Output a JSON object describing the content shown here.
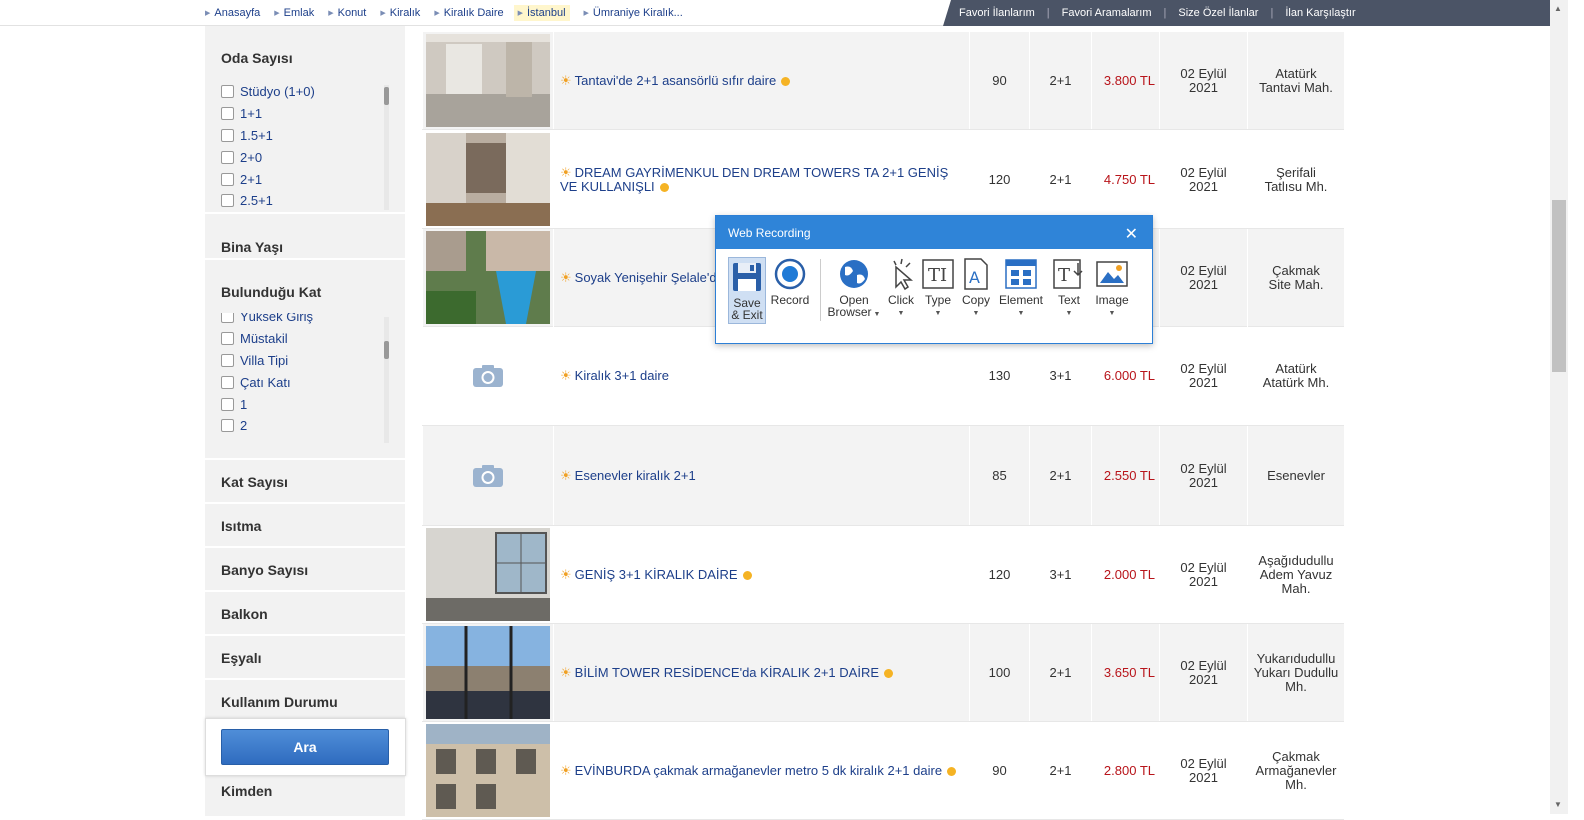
{
  "breadcrumbs": [
    "Anasayfa",
    "Emlak",
    "Konut",
    "Kiralık",
    "Kiralık Daire",
    "İstanbul",
    "Ümraniye Kiralık..."
  ],
  "top_links": [
    "Favori İlanlarım",
    "Favori Aramalarım",
    "Size Özel İlanlar",
    "İlan Karşılaştır"
  ],
  "sidebar": {
    "oda_sayisi": {
      "title": "Oda Sayısı",
      "options": [
        "Stüdyo (1+0)",
        "1+1",
        "1.5+1",
        "2+0",
        "2+1",
        "2.5+1"
      ]
    },
    "bina_yasi": "Bina Yaşı",
    "bulundugu_kat": {
      "title": "Bulunduğu Kat",
      "options": [
        "Yüksek Giriş",
        "Müstakil",
        "Villa Tipi",
        "Çatı Katı",
        "1",
        "2"
      ]
    },
    "kat_sayisi": "Kat Sayısı",
    "isitma": "Isıtma",
    "banyo_sayisi": "Banyo Sayısı",
    "balkon": "Balkon",
    "esyali": "Eşyalı",
    "kullanim_durumu": "Kullanım Durumu",
    "kimden": "Kimden",
    "search_button": "Ara"
  },
  "listings": [
    {
      "title": "Tantavi'de 2+1 asansörlü sıfır daire",
      "m2": "90",
      "rooms": "2+1",
      "price": "3.800 TL",
      "date1": "02 Eylül",
      "date2": "2021",
      "loc1": "Atatürk",
      "loc2": "Tantavi Mah.",
      "loc3": "",
      "photo": "room"
    },
    {
      "title": "DREAM GAYRİMENKUL DEN DREAM TOWERS TA 2+1 GENİŞ VE KULLANIŞLI",
      "m2": "120",
      "rooms": "2+1",
      "price": "4.750 TL",
      "date1": "02 Eylül",
      "date2": "2021",
      "loc1": "Şerifali",
      "loc2": "Tatlısu Mh.",
      "loc3": "",
      "photo": "kitchen"
    },
    {
      "title": "Soyak Yenişehir Şelale'de",
      "m2": "",
      "rooms": "",
      "price": "",
      "date1": "02 Eylül",
      "date2": "2021",
      "loc1": "Çakmak",
      "loc2": "Site Mah.",
      "loc3": "",
      "photo": "pool"
    },
    {
      "title": "Kiralık 3+1 daire",
      "m2": "130",
      "rooms": "3+1",
      "price": "6.000 TL",
      "date1": "02 Eylül",
      "date2": "2021",
      "loc1": "Atatürk",
      "loc2": "Atatürk Mh.",
      "loc3": "",
      "photo": "none"
    },
    {
      "title": "Esenevler kiralık 2+1",
      "m2": "85",
      "rooms": "2+1",
      "price": "2.550 TL",
      "date1": "02 Eylül",
      "date2": "2021",
      "loc1": "Esenevler",
      "loc2": "",
      "loc3": "",
      "photo": "none"
    },
    {
      "title": "GENİŞ 3+1 KİRALIK DAİRE",
      "m2": "120",
      "rooms": "3+1",
      "price": "2.000 TL",
      "date1": "02 Eylül",
      "date2": "2021",
      "loc1": "Aşağıdudullu",
      "loc2": "Adem Yavuz",
      "loc3": "Mah.",
      "photo": "window"
    },
    {
      "title": "BİLİM TOWER RESİDENCE'da KİRALIK 2+1 DAİRE",
      "m2": "100",
      "rooms": "2+1",
      "price": "3.650 TL",
      "date1": "02 Eylül",
      "date2": "2021",
      "loc1": "Yukarıdudullu",
      "loc2": "Yukarı Dudullu",
      "loc3": "Mh.",
      "photo": "view"
    },
    {
      "title": "EVİNBURDA çakmak armağanevler metro 5 dk kiralık 2+1 daire",
      "m2": "90",
      "rooms": "2+1",
      "price": "2.800 TL",
      "date1": "02 Eylül",
      "date2": "2021",
      "loc1": "Çakmak",
      "loc2": "Armağanevler",
      "loc3": "Mh.",
      "photo": "building"
    }
  ],
  "dialog": {
    "title": "Web Recording",
    "tools": {
      "save": [
        "Save",
        "& Exit"
      ],
      "record": "Record",
      "open_browser": [
        "Open",
        "Browser"
      ],
      "click": "Click",
      "type": "Type",
      "copy": "Copy",
      "element": "Element",
      "text": "Text",
      "image": "Image"
    }
  },
  "colors": {
    "accent": "#2f84d8",
    "link": "#1d3f8a",
    "price": "#b8141a",
    "topbar_dark": "#4b5466"
  }
}
